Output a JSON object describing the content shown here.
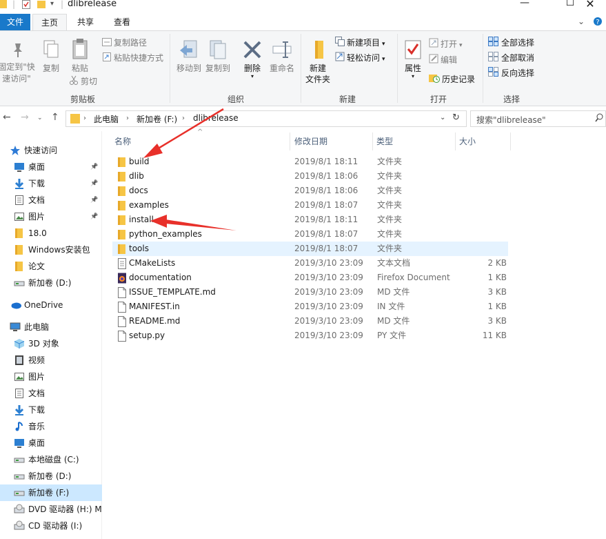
{
  "window": {
    "title": "dlibrelease",
    "minimize": "—",
    "maximize": "☐",
    "close": "✕"
  },
  "tabs": {
    "file": "文件",
    "home": "主页",
    "share": "共享",
    "view": "查看"
  },
  "ribbon": {
    "clipboard": {
      "label": "剪贴板",
      "pin": "固定到\"快\n速访问\"",
      "copy": "复制",
      "paste": "粘贴",
      "copy_path": "复制路径",
      "paste_shortcut": "粘贴快捷方式",
      "cut": "剪切"
    },
    "organize": {
      "label": "组织",
      "move_to": "移动到",
      "copy_to": "复制到",
      "delete": "删除",
      "rename": "重命名"
    },
    "new": {
      "label": "新建",
      "new_folder": "新建\n文件夹",
      "new_item": "新建项目",
      "easy_access": "轻松访问"
    },
    "open": {
      "label": "打开",
      "properties": "属性",
      "open": "打开",
      "edit": "编辑",
      "history": "历史记录"
    },
    "select": {
      "label": "选择",
      "select_all": "全部选择",
      "select_none": "全部取消",
      "invert": "反向选择"
    }
  },
  "address": {
    "path": [
      "此电脑",
      "新加卷 (F:)",
      "dlibrelease"
    ],
    "search_placeholder": "搜索\"dlibrelease\""
  },
  "sidebar": {
    "items": [
      {
        "label": "快速访问",
        "icon": "star-icon",
        "indent": 0,
        "pinned": false
      },
      {
        "label": "桌面",
        "icon": "desktop-icon",
        "indent": 1,
        "pinned": true
      },
      {
        "label": "下载",
        "icon": "download-icon",
        "indent": 1,
        "pinned": true
      },
      {
        "label": "文档",
        "icon": "document-icon",
        "indent": 1,
        "pinned": true
      },
      {
        "label": "图片",
        "icon": "picture-icon",
        "indent": 1,
        "pinned": true
      },
      {
        "label": "18.0",
        "icon": "folder-icon",
        "indent": 1,
        "pinned": false
      },
      {
        "label": "Windows安装包",
        "icon": "folder-icon",
        "indent": 1,
        "pinned": false
      },
      {
        "label": "论文",
        "icon": "folder-icon",
        "indent": 1,
        "pinned": false
      },
      {
        "label": "新加卷 (D:)",
        "icon": "drive-icon",
        "indent": 1,
        "pinned": false
      },
      {
        "label": "OneDrive",
        "icon": "cloud-icon",
        "indent": 0,
        "pinned": false
      },
      {
        "label": "此电脑",
        "icon": "computer-icon",
        "indent": 0,
        "pinned": false
      },
      {
        "label": "3D 对象",
        "icon": "cube-icon",
        "indent": 1,
        "pinned": false
      },
      {
        "label": "视频",
        "icon": "video-icon",
        "indent": 1,
        "pinned": false
      },
      {
        "label": "图片",
        "icon": "picture-icon",
        "indent": 1,
        "pinned": false
      },
      {
        "label": "文档",
        "icon": "document-icon",
        "indent": 1,
        "pinned": false
      },
      {
        "label": "下载",
        "icon": "download-icon",
        "indent": 1,
        "pinned": false
      },
      {
        "label": "音乐",
        "icon": "music-icon",
        "indent": 1,
        "pinned": false
      },
      {
        "label": "桌面",
        "icon": "desktop-icon",
        "indent": 1,
        "pinned": false
      },
      {
        "label": "本地磁盘 (C:)",
        "icon": "drive-icon",
        "indent": 1,
        "pinned": false
      },
      {
        "label": "新加卷 (D:)",
        "icon": "drive-icon",
        "indent": 1,
        "pinned": false
      },
      {
        "label": "新加卷 (F:)",
        "icon": "drive-icon",
        "indent": 1,
        "pinned": false,
        "selected": true
      },
      {
        "label": "DVD 驱动器 (H:) M",
        "icon": "disc-icon",
        "indent": 1,
        "pinned": false
      },
      {
        "label": "CD 驱动器 (I:)",
        "icon": "disc-icon",
        "indent": 1,
        "pinned": false
      }
    ]
  },
  "list": {
    "columns": {
      "name": "名称",
      "date": "修改日期",
      "type": "类型",
      "size": "大小"
    },
    "rows": [
      {
        "name": "build",
        "date": "2019/8/1 18:11",
        "type": "文件夹",
        "size": "",
        "icon": "folder-icon"
      },
      {
        "name": "dlib",
        "date": "2019/8/1 18:06",
        "type": "文件夹",
        "size": "",
        "icon": "folder-icon"
      },
      {
        "name": "docs",
        "date": "2019/8/1 18:06",
        "type": "文件夹",
        "size": "",
        "icon": "folder-icon"
      },
      {
        "name": "examples",
        "date": "2019/8/1 18:07",
        "type": "文件夹",
        "size": "",
        "icon": "folder-icon"
      },
      {
        "name": "install",
        "date": "2019/8/1 18:11",
        "type": "文件夹",
        "size": "",
        "icon": "folder-icon"
      },
      {
        "name": "python_examples",
        "date": "2019/8/1 18:07",
        "type": "文件夹",
        "size": "",
        "icon": "folder-icon"
      },
      {
        "name": "tools",
        "date": "2019/8/1 18:07",
        "type": "文件夹",
        "size": "",
        "icon": "folder-icon",
        "hover": true
      },
      {
        "name": "CMakeLists",
        "date": "2019/3/10 23:09",
        "type": "文本文档",
        "size": "2 KB",
        "icon": "text-file-icon"
      },
      {
        "name": "documentation",
        "date": "2019/3/10 23:09",
        "type": "Firefox Document",
        "size": "1 KB",
        "icon": "firefox-icon"
      },
      {
        "name": "ISSUE_TEMPLATE.md",
        "date": "2019/3/10 23:09",
        "type": "MD 文件",
        "size": "3 KB",
        "icon": "file-icon"
      },
      {
        "name": "MANIFEST.in",
        "date": "2019/3/10 23:09",
        "type": "IN 文件",
        "size": "1 KB",
        "icon": "file-icon"
      },
      {
        "name": "README.md",
        "date": "2019/3/10 23:09",
        "type": "MD 文件",
        "size": "3 KB",
        "icon": "file-icon"
      },
      {
        "name": "setup.py",
        "date": "2019/3/10 23:09",
        "type": "PY 文件",
        "size": "11 KB",
        "icon": "file-icon"
      }
    ]
  },
  "colors": {
    "accent": "#1979ca",
    "selected": "#cce8ff",
    "hover": "#e5f3ff",
    "annotation_arrow": "#e8302a"
  }
}
